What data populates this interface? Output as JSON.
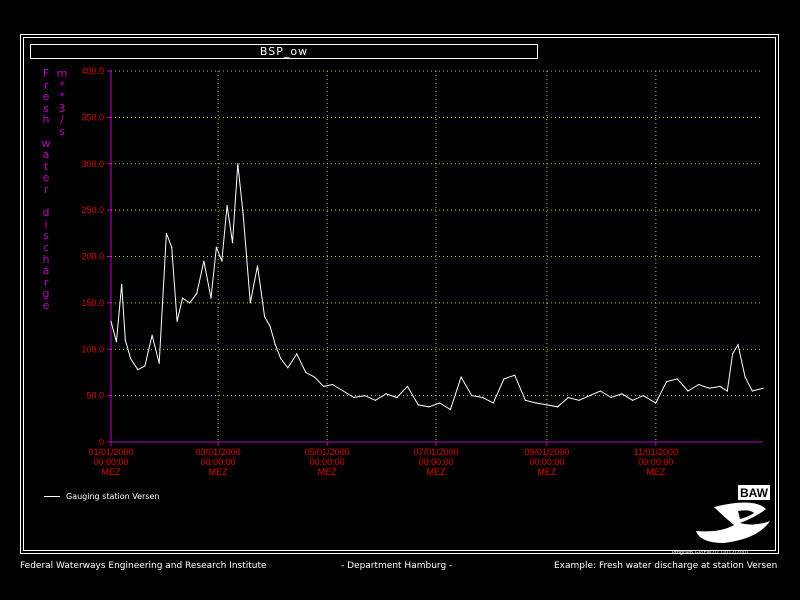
{
  "chart_data": {
    "type": "line",
    "title": "BSP_ow",
    "ylabel": [
      "Fresh water discharge",
      "m**3/s"
    ],
    "ylim": [
      0,
      400
    ],
    "yticks": [
      "0",
      "50.0",
      "100.0",
      "150.0",
      "200.0",
      "250.0",
      "300.0",
      "350.0",
      "400.0"
    ],
    "xlim": [
      "01/01/2000",
      "12/31/2000"
    ],
    "xticks": [
      {
        "date": "01/01/2000",
        "time": "00:00:00",
        "tz": "MEZ"
      },
      {
        "date": "03/01/2000",
        "time": "00:00:00",
        "tz": "MEZ"
      },
      {
        "date": "05/01/2000",
        "time": "00:00:00",
        "tz": "MEZ"
      },
      {
        "date": "07/01/2000",
        "time": "00:00:00",
        "tz": "MEZ"
      },
      {
        "date": "09/01/2000",
        "time": "00:00:00",
        "tz": "MEZ"
      },
      {
        "date": "11/01/2000",
        "time": "00:00:00",
        "tz": "MEZ"
      }
    ],
    "grid": true,
    "legend_position": "bottom-left",
    "colors": {
      "axis": "#c000c0",
      "grid": "#c8c800",
      "series": "#ffffff",
      "tick_labels_x": "#e00000",
      "tick_labels_y": "#e00000"
    },
    "series": [
      {
        "name": "Gauging station Versen",
        "x": [
          "01/01/2000",
          "01/04/2000",
          "01/07/2000",
          "01/09/2000",
          "01/12/2000",
          "01/16/2000",
          "01/20/2000",
          "01/24/2000",
          "01/28/2000",
          "02/01/2000",
          "02/04/2000",
          "02/07/2000",
          "02/10/2000",
          "02/14/2000",
          "02/18/2000",
          "02/22/2000",
          "02/26/2000",
          "02/29/2000",
          "03/03/2000",
          "03/06/2000",
          "03/09/2000",
          "03/12/2000",
          "03/15/2000",
          "03/19/2000",
          "03/23/2000",
          "03/27/2000",
          "03/30/2000",
          "04/02/2000",
          "04/05/2000",
          "04/09/2000",
          "04/14/2000",
          "04/19/2000",
          "04/24/2000",
          "04/29/2000",
          "05/04/2000",
          "05/10/2000",
          "05/16/2000",
          "05/22/2000",
          "05/28/2000",
          "06/03/2000",
          "06/09/2000",
          "06/15/2000",
          "06/21/2000",
          "06/27/2000",
          "07/03/2000",
          "07/09/2000",
          "07/15/2000",
          "07/21/2000",
          "07/27/2000",
          "08/02/2000",
          "08/08/2000",
          "08/14/2000",
          "08/20/2000",
          "08/26/2000",
          "09/01/2000",
          "09/07/2000",
          "09/13/2000",
          "09/19/2000",
          "09/25/2000",
          "10/01/2000",
          "10/07/2000",
          "10/13/2000",
          "10/19/2000",
          "10/25/2000",
          "11/01/2000",
          "11/07/2000",
          "11/13/2000",
          "11/19/2000",
          "11/25/2000",
          "12/01/2000",
          "12/07/2000",
          "12/11/2000",
          "12/14/2000",
          "12/17/2000",
          "12/21/2000",
          "12/25/2000",
          "12/31/2000"
        ],
        "values": [
          130,
          108,
          170,
          110,
          90,
          78,
          82,
          115,
          85,
          225,
          210,
          130,
          155,
          150,
          160,
          195,
          155,
          210,
          195,
          255,
          215,
          300,
          245,
          150,
          190,
          135,
          125,
          105,
          90,
          80,
          95,
          75,
          70,
          60,
          62,
          55,
          48,
          50,
          45,
          52,
          48,
          60,
          40,
          38,
          42,
          35,
          70,
          50,
          48,
          42,
          68,
          72,
          45,
          42,
          40,
          38,
          48,
          45,
          50,
          55,
          48,
          52,
          45,
          50,
          42,
          65,
          68,
          55,
          62,
          58,
          60,
          55,
          95,
          105,
          70,
          55,
          58
        ]
      }
    ]
  },
  "legend": {
    "label": "Gauging station Versen"
  },
  "logo": {
    "text": "BAW"
  },
  "program_line": "Program GVIEW2D     10/12/2001",
  "footer": {
    "left": "Federal Waterways Engineering and Research Institute",
    "center": "- Department Hamburg -",
    "right": "Example: Fresh water discharge at station Versen"
  }
}
